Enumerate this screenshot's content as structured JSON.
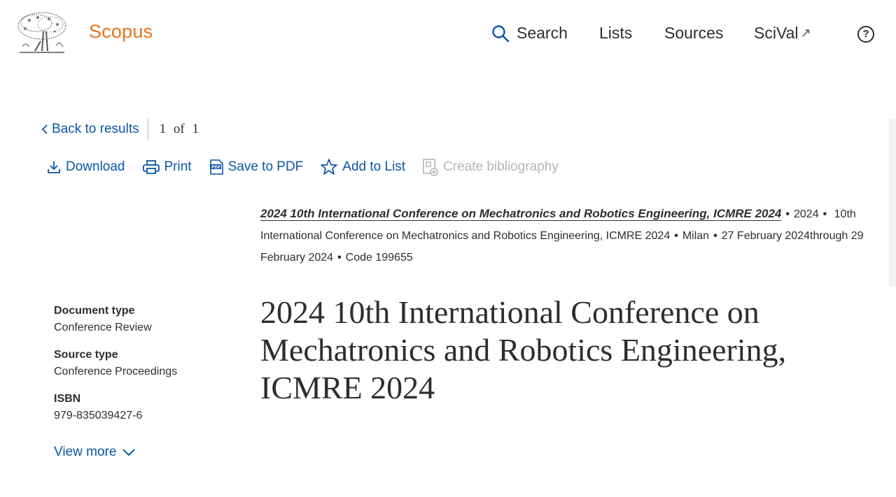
{
  "header": {
    "brand": "Scopus",
    "nav": {
      "search": "Search",
      "lists": "Lists",
      "sources": "Sources",
      "scival": "SciVal",
      "scival_ext": "↗",
      "help": "?"
    },
    "colors": {
      "brand": "#e9711c",
      "link": "#0c55a5"
    }
  },
  "back_row": {
    "back_label": "Back to results",
    "pager_current": "1",
    "pager_of": "of",
    "pager_total": "1"
  },
  "toolbar": {
    "download": "Download",
    "print": "Print",
    "save_pdf": "Save to PDF",
    "add_list": "Add to List",
    "create_bib": "Create bibliography"
  },
  "source": {
    "journal": "2024 10th International Conference on Mechatronics and Robotics Engineering, ICMRE 2024",
    "year": "2024",
    "conference": "10th International Conference on Mechatronics and Robotics Engineering, ICMRE 2024",
    "location": "Milan",
    "dates": "27 February 2024through 29 February 2024",
    "code": "Code 199655"
  },
  "document": {
    "title": "2024 10th International Conference on Mechatronics and Robotics Engineering, ICMRE 2024"
  },
  "meta": {
    "doc_type_label": "Document type",
    "doc_type_value": "Conference Review",
    "source_type_label": "Source type",
    "source_type_value": "Conference Proceedings",
    "isbn_label": "ISBN",
    "isbn_value": "979-835039427-6",
    "view_more": "View more"
  }
}
